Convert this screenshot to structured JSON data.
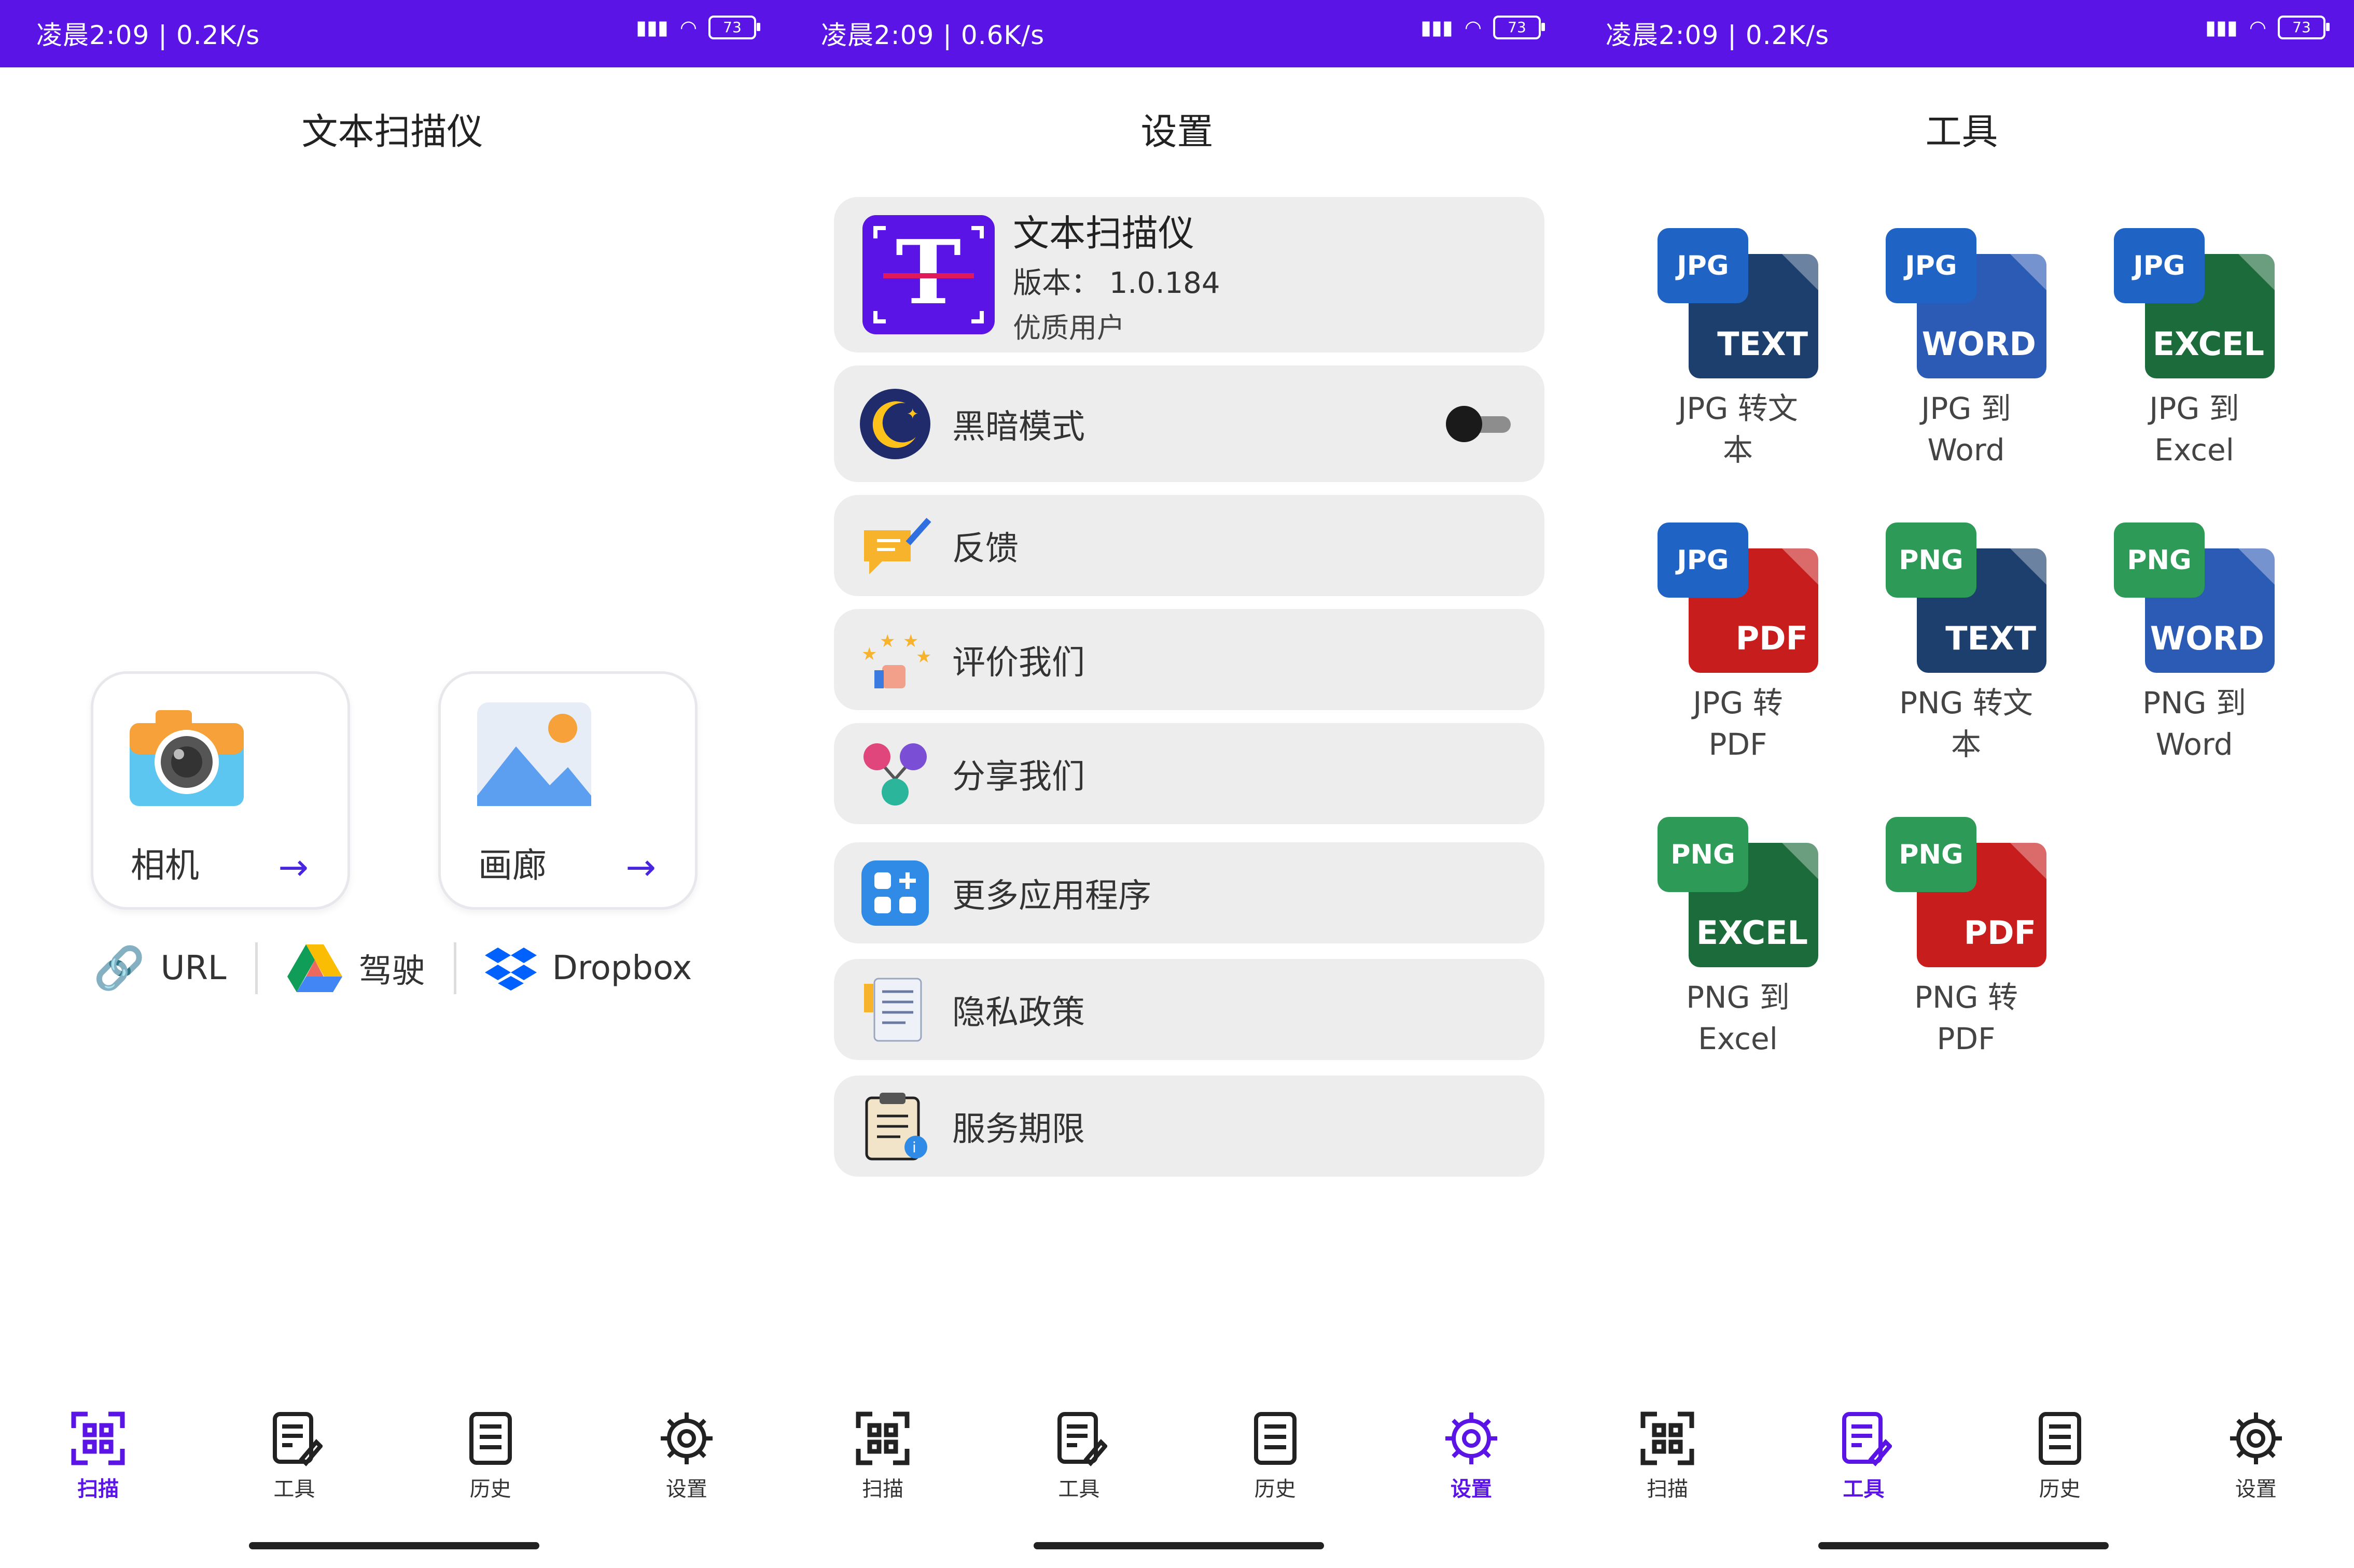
{
  "panels": [
    {
      "status": {
        "time": "凌晨2:09 | 0.2K/s",
        "battery": "73"
      },
      "title": "文本扫描仪",
      "camera_label": "相机",
      "gallery_label": "画廊",
      "sources": [
        "URL",
        "驾驶",
        "Dropbox"
      ],
      "nav": [
        "扫描",
        "工具",
        "历史",
        "设置"
      ],
      "active_tab": 0
    },
    {
      "status": {
        "time": "凌晨2:09 | 0.6K/s",
        "battery": "73"
      },
      "title": "设置",
      "app": {
        "name": "文本扫描仪",
        "version": "版本： 1.0.184",
        "tier": "优质用户"
      },
      "items": [
        "黑暗模式",
        "反馈",
        "评价我们",
        "分享我们",
        "更多应用程序",
        "隐私政策",
        "服务期限"
      ],
      "nav": [
        "扫描",
        "工具",
        "历史",
        "设置"
      ],
      "active_tab": 3
    },
    {
      "status": {
        "time": "凌晨2:09 | 0.2K/s",
        "battery": "73"
      },
      "title": "工具",
      "tools": [
        {
          "tag": "JPG",
          "doc": "TEXT",
          "label1": "JPG 转文",
          "label2": "本"
        },
        {
          "tag": "JPG",
          "doc": "WORD",
          "label1": "JPG 到",
          "label2": "Word"
        },
        {
          "tag": "JPG",
          "doc": "EXCEL",
          "label1": "JPG 到",
          "label2": "Excel"
        },
        {
          "tag": "JPG",
          "doc": "PDF",
          "label1": "JPG 转",
          "label2": "PDF"
        },
        {
          "tag": "PNG",
          "doc": "TEXT",
          "label1": "PNG 转文",
          "label2": "本"
        },
        {
          "tag": "PNG",
          "doc": "WORD",
          "label1": "PNG 到",
          "label2": "Word"
        },
        {
          "tag": "PNG",
          "doc": "EXCEL",
          "label1": "PNG 到",
          "label2": "Excel"
        },
        {
          "tag": "PNG",
          "doc": "PDF",
          "label1": "PNG 转",
          "label2": "PDF"
        }
      ],
      "nav": [
        "扫描",
        "工具",
        "历史",
        "设置"
      ],
      "active_tab": 1
    }
  ],
  "colors": {
    "accent": "#5a14e6",
    "jpg": "#1f63c4",
    "png": "#2e9a57",
    "text_doc": "#1d3f6e",
    "word_doc": "#2c5bb5",
    "excel_doc": "#1c6b3a",
    "pdf_doc": "#c81d1d"
  }
}
